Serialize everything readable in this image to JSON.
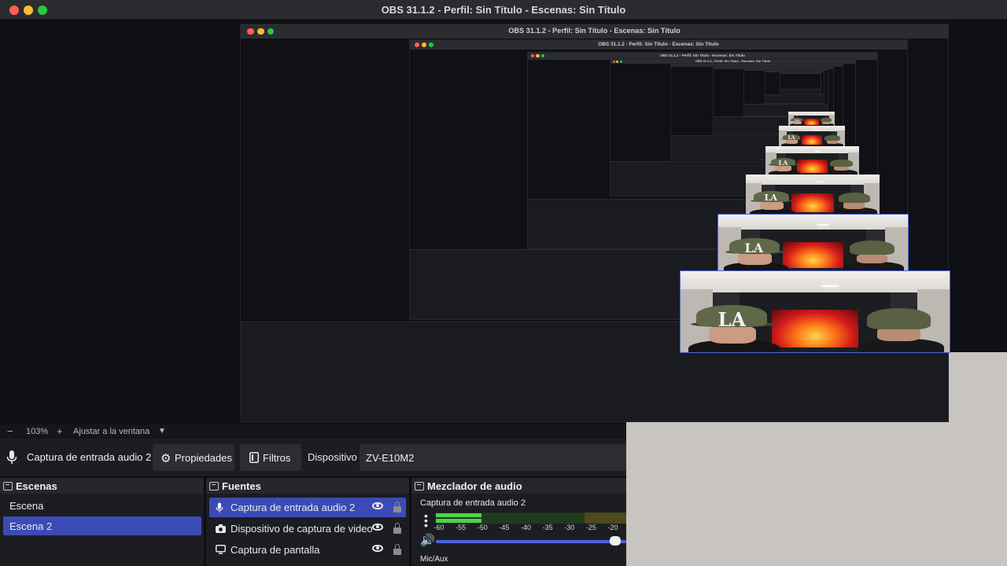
{
  "window": {
    "title": "OBS 31.1.2 - Perfil: Sin Título - Escenas: Sin Título"
  },
  "preview": {
    "zoom_minus": "−",
    "zoom_value": "103%",
    "zoom_plus": "+",
    "fit_label": "Ajustar a la ventana",
    "fit_caret": "▼"
  },
  "context_bar": {
    "source_name": "Captura de entrada audio 2",
    "properties_label": "Propiedades",
    "filters_label": "Filtros",
    "device_label": "Dispositivo",
    "device_value": "ZV-E10M2"
  },
  "scenes": {
    "title": "Escenas",
    "items": [
      {
        "label": "Escena",
        "active": false
      },
      {
        "label": "Escena 2",
        "active": true
      }
    ]
  },
  "sources": {
    "title": "Fuentes",
    "items": [
      {
        "label": "Captura de entrada audio 2",
        "icon": "microphone-icon",
        "active": true
      },
      {
        "label": "Dispositivo de captura de video",
        "icon": "camera-icon",
        "active": false
      },
      {
        "label": "Captura de pantalla",
        "icon": "monitor-icon",
        "active": false
      }
    ]
  },
  "mixer": {
    "title": "Mezclador de audio",
    "channel_name": "Captura de entrada audio 2",
    "ticks": [
      "-60",
      "-55",
      "-50",
      "-45",
      "-40",
      "-35",
      "-30",
      "-25",
      "-20"
    ],
    "bus_label": "Mic/Aux",
    "level_fraction": 0.24,
    "volume_fraction": 0.97
  },
  "colors": {
    "accent": "#3b4bb5",
    "meter_green": "#4ed24e",
    "traffic_close": "#ff5f57",
    "traffic_min": "#febc2e",
    "traffic_max": "#28c840"
  }
}
